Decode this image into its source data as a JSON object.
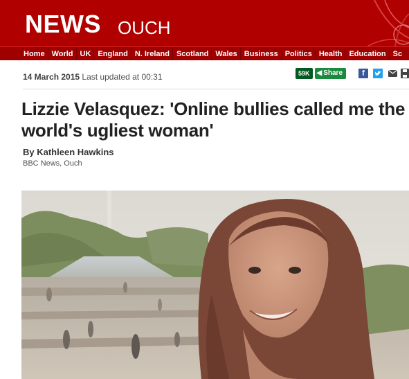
{
  "header": {
    "brand": "NEWS",
    "section": "OUCH",
    "colors": {
      "masthead": "#b00000",
      "nav": "#9f0000"
    }
  },
  "nav": {
    "items": [
      "Home",
      "World",
      "UK",
      "England",
      "N. Ireland",
      "Scotland",
      "Wales",
      "Business",
      "Politics",
      "Health",
      "Education",
      "Sc"
    ]
  },
  "article": {
    "date": "14 March 2015",
    "updated": "Last updated at 00:31",
    "share_count": "59K",
    "share_label": "Share",
    "headline": "Lizzie Velasquez: 'Online bullies called me the world's ugliest woman'",
    "author": "By Kathleen Hawkins",
    "organization": "BBC News, Ouch"
  },
  "icons": {
    "share": "share-icon",
    "facebook": "facebook-icon",
    "twitter": "twitter-icon",
    "email": "email-icon",
    "print": "print-icon"
  }
}
